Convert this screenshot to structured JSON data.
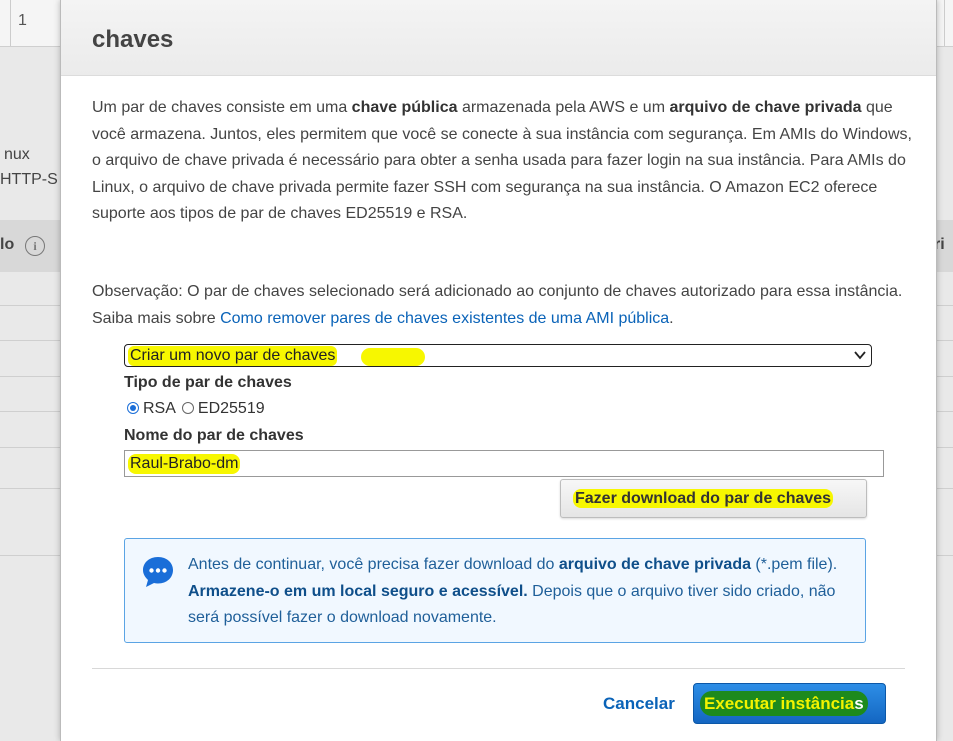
{
  "background": {
    "row_number": "1",
    "text_1": "nux",
    "text_2": "HTTP-S",
    "header_left": "lo",
    "header_right": "ri"
  },
  "modal": {
    "title": "chaves",
    "intro": {
      "p1": "Um par de chaves consiste em uma ",
      "b1": "chave pública",
      "p2": " armazenada pela AWS e um ",
      "b2": "arquivo de chave privada",
      "p3": " que você armazena. Juntos, eles permitem que você se conecte à sua instância com segurança. Em AMIs do Windows, o arquivo de chave privada é necessário para obter a senha usada para fazer login na sua instância. Para AMIs do Linux, o arquivo de chave privada permite fazer SSH com segurança na sua instância. O Amazon EC2 oferece suporte aos tipos de par de chaves ED25519 e RSA."
    },
    "note": {
      "text": "Observação: O par de chaves selecionado será adicionado ao conjunto de chaves autorizado para essa instância. Saiba mais sobre ",
      "link": "Como remover pares de chaves existentes de uma AMI pública",
      "end": "."
    },
    "key_pair_select": {
      "selected": "Criar um novo par de chaves"
    },
    "key_type_label": "Tipo de par de chaves",
    "key_types": [
      {
        "label": "RSA",
        "checked": true
      },
      {
        "label": "ED25519",
        "checked": false
      }
    ],
    "key_name_label": "Nome do par de chaves",
    "key_name_value": "Raul-Brabo-dm",
    "download_button": "Fazer download do par de chaves",
    "info": {
      "p1": "Antes de continuar, você precisa fazer download do ",
      "b1": "arquivo de chave privada",
      "p2": " (*.pem file). ",
      "b2": "Armazene-o em um local seguro e acessível.",
      "p3": " Depois que o arquivo tiver sido criado, não será possível fazer o download novamente."
    },
    "cancel_label": "Cancelar",
    "launch_label_main": "Executar instância",
    "launch_label_tail": "s",
    "highlight_color": "#f7f700",
    "primary_color": "#1466c2",
    "link_color": "#0a63b8"
  }
}
